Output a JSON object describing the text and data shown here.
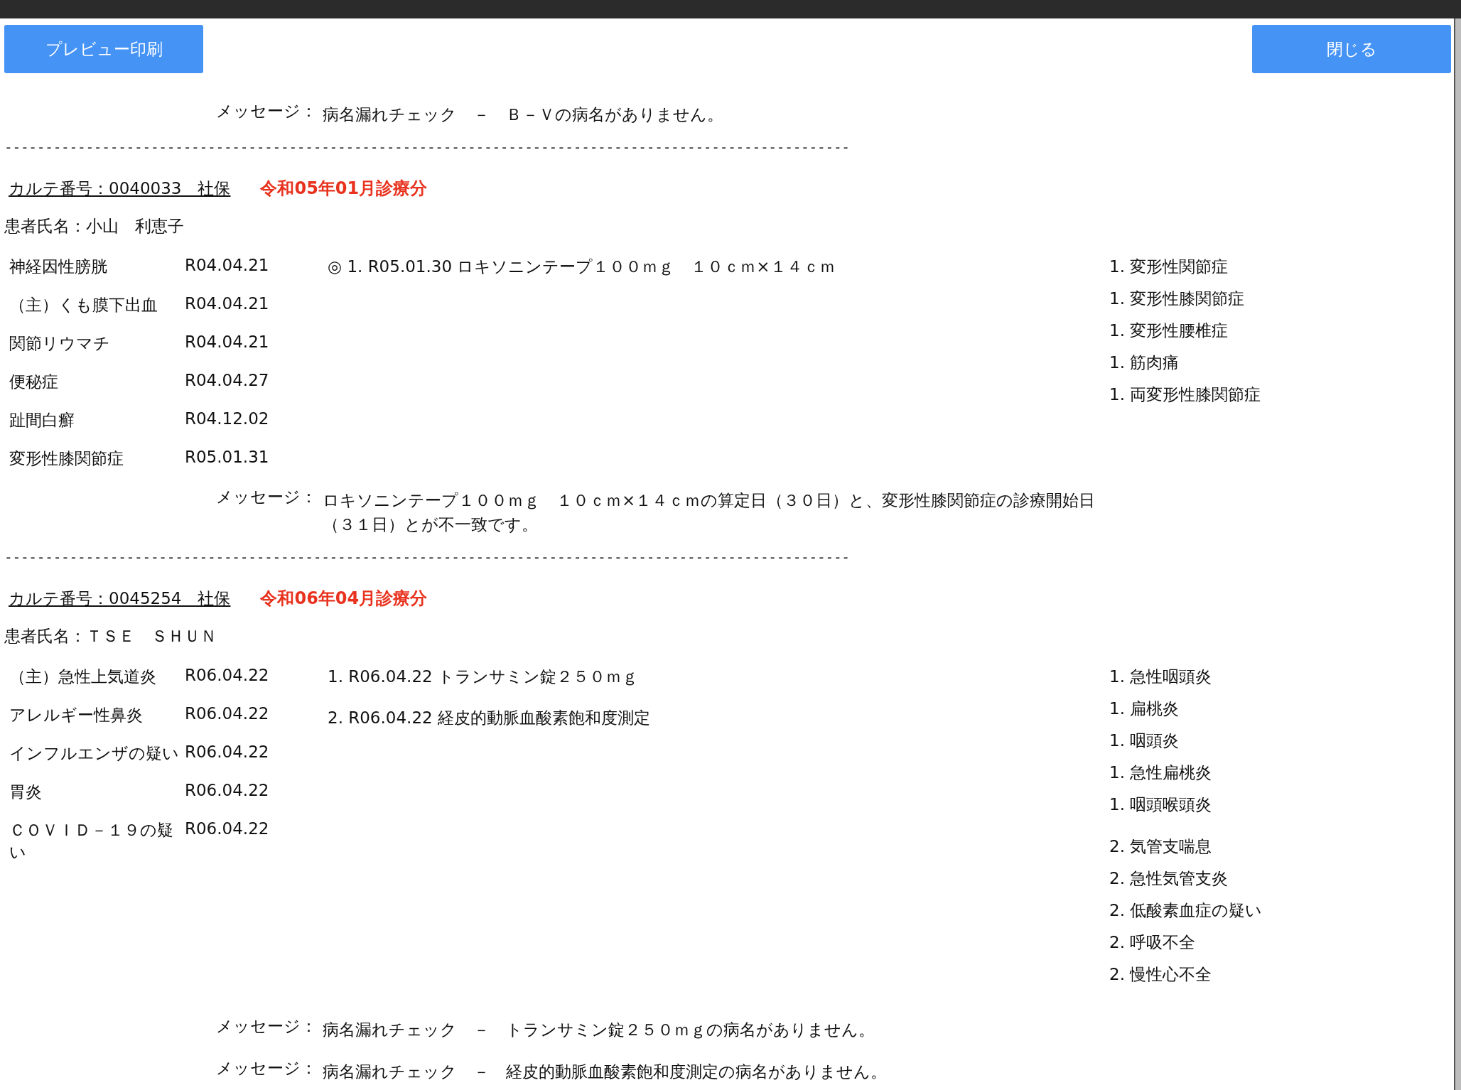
{
  "toolbar": {
    "buttons": [
      {
        "label": "プレビュー印刷",
        "kind": "left"
      },
      {
        "label": "閉じる",
        "kind": "right"
      }
    ]
  },
  "sections": [
    {
      "messages": [
        {
          "label": "メッセージ：",
          "text": "病名漏れチェック　－　Ｂ－Ｖの病名がありません。"
        }
      ]
    },
    {
      "separator": "--------------------------------------------------------------------------------------------------------",
      "karte": "カルテ番号：0040033　社保",
      "period": "令和05年01月診療分",
      "patient": "患者氏名：小山　利恵子",
      "diagnoses": [
        {
          "name": "神経因性膀胱",
          "date": "R04.04.21"
        },
        {
          "name": "（主）くも膜下出血",
          "date": "R04.04.21"
        },
        {
          "name": "関節リウマチ",
          "date": "R04.04.21"
        },
        {
          "name": "便秘症",
          "date": "R04.04.27"
        },
        {
          "name": "趾間白癬",
          "date": "R04.12.02"
        },
        {
          "name": "変形性膝関節症",
          "date": "R05.01.31"
        }
      ],
      "orders": [
        "◎ 1. R05.01.30 ロキソニンテープ１００ｍｇ　１０ｃｍ×１４ｃｍ"
      ],
      "related": [
        [
          "1. 変形性関節症",
          "1. 変形性膝関節症",
          "1. 変形性腰椎症",
          "1. 筋肉痛",
          "1. 両変形性膝関節症"
        ]
      ],
      "messages": [
        {
          "label": "メッセージ：",
          "text": "ロキソニンテープ１００ｍｇ　１０ｃｍ×１４ｃｍの算定日（３０日）と、変形性膝関節症の診療開始日（３１日）とが不一致です。"
        }
      ]
    },
    {
      "separator": "--------------------------------------------------------------------------------------------------------",
      "karte": "カルテ番号：0045254　社保",
      "period": "令和06年04月診療分",
      "patient": "患者氏名：ＴＳＥ　ＳＨＵＮ",
      "diagnoses": [
        {
          "name": "（主）急性上気道炎",
          "date": "R06.04.22"
        },
        {
          "name": "アレルギー性鼻炎",
          "date": "R06.04.22"
        },
        {
          "name": "インフルエンザの疑い",
          "date": "R06.04.22"
        },
        {
          "name": "胃炎",
          "date": "R06.04.22"
        },
        {
          "name": "ＣＯＶＩＤ－１９の疑い",
          "date": "R06.04.22"
        }
      ],
      "orders": [
        "1. R06.04.22 トランサミン錠２５０ｍｇ",
        "2. R06.04.22 経皮的動脈血酸素飽和度測定"
      ],
      "related": [
        [
          "1. 急性咽頭炎",
          "1. 扁桃炎",
          "1. 咽頭炎",
          "1. 急性扁桃炎",
          "1. 咽頭喉頭炎"
        ],
        [
          "2. 気管支喘息",
          "2. 急性気管支炎",
          "2. 低酸素血症の疑い",
          "2. 呼吸不全",
          "2. 慢性心不全"
        ]
      ],
      "messages": [
        {
          "label": "メッセージ：",
          "text": "病名漏れチェック　－　トランサミン錠２５０ｍｇの病名がありません。"
        },
        {
          "label": "メッセージ：",
          "text": "病名漏れチェック　－　経皮的動脈血酸素飽和度測定の病名がありません。"
        }
      ]
    }
  ]
}
